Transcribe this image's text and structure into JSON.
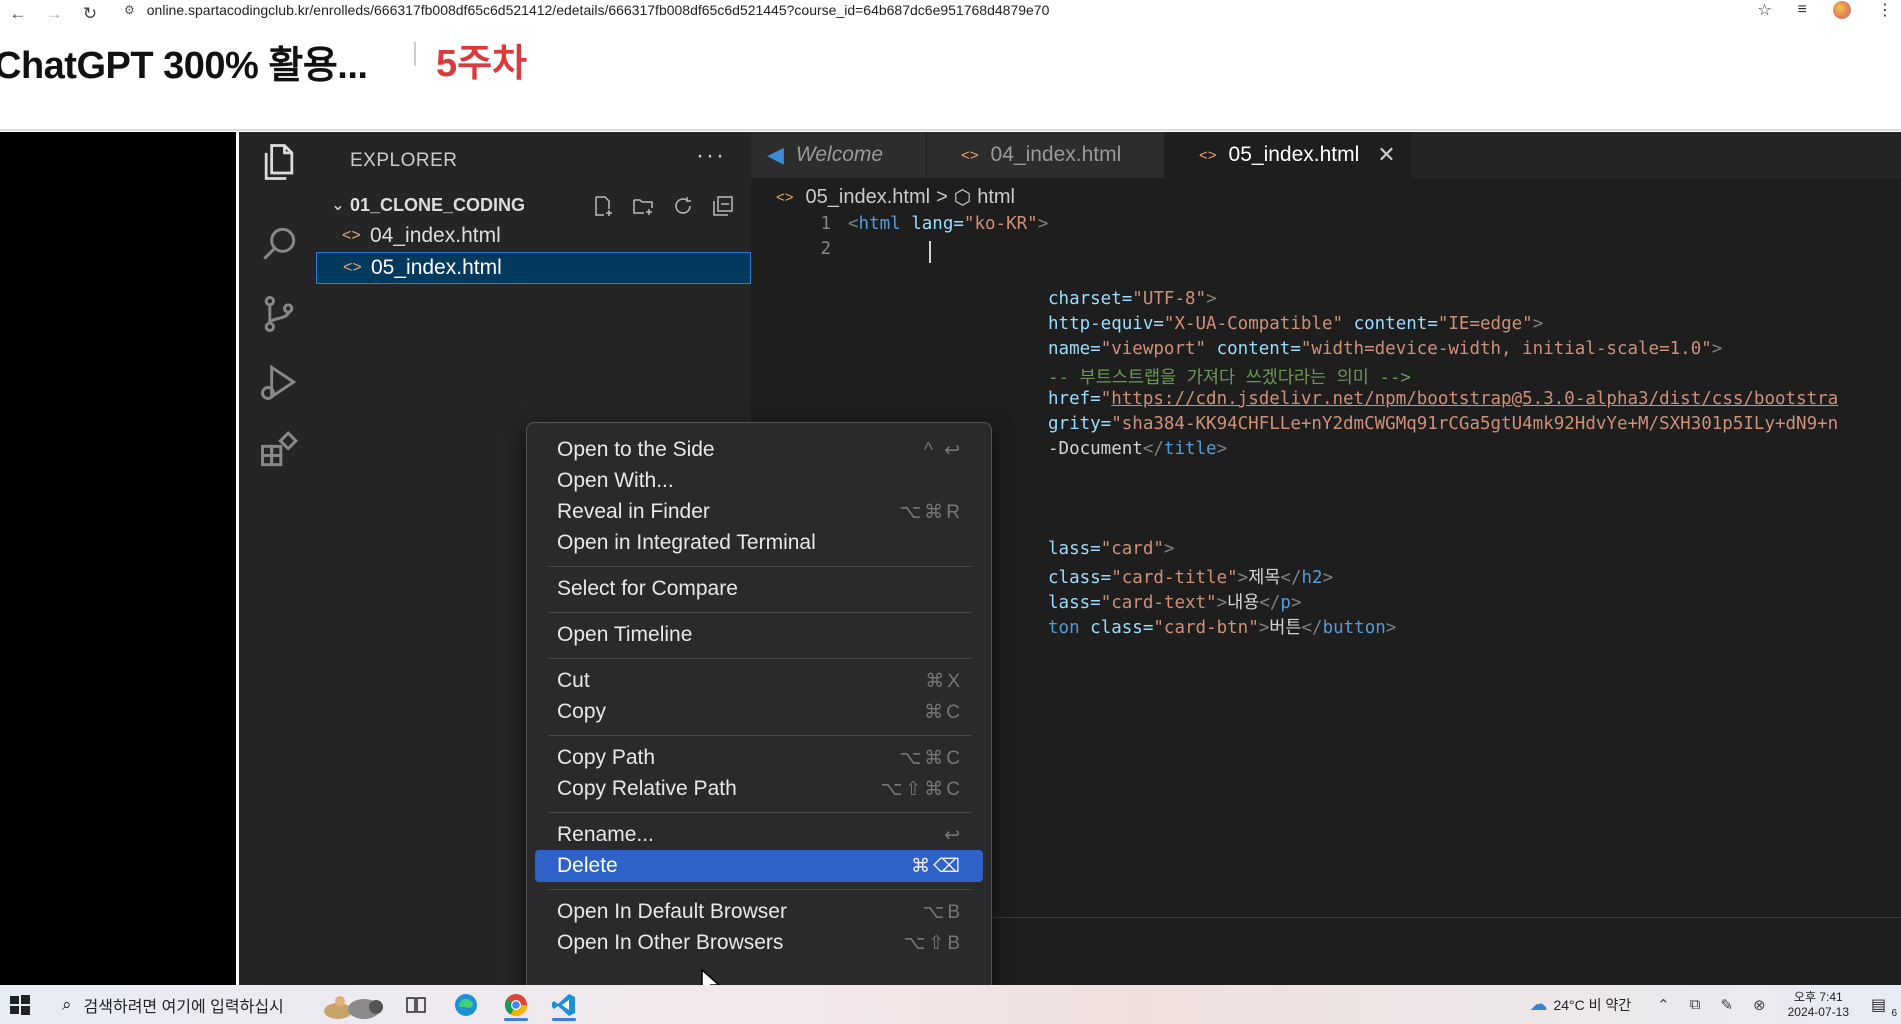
{
  "browser": {
    "url": "online.spartacodingclub.kr/enrolleds/666317fb008df65c6d521412/edetails/666317fb008df65c6d521445?course_id=64b687dc6e951768d4879e70"
  },
  "page": {
    "course_title": "ChatGPT 300% 활용...",
    "week_label": "5주차"
  },
  "vscode": {
    "sidebar": {
      "title": "EXPLORER",
      "more": "···",
      "folder": "01_CLONE_CODING",
      "files": [
        "04_index.html",
        "05_index.html"
      ]
    },
    "tabs": [
      {
        "label": "Welcome"
      },
      {
        "label": "04_index.html"
      },
      {
        "label": "05_index.html",
        "close": "✕"
      }
    ],
    "breadcrumb": {
      "file": "05_index.html",
      "separator": ">",
      "symbol": "html"
    },
    "editor": {
      "line_numbers": [
        "1",
        "2"
      ],
      "lines": {
        "l1": {
          "open": "<",
          "tag": "html",
          "attr": " lang=",
          "val": "\"ko-KR\"",
          "close": ">"
        },
        "l3": {
          "attr": "charset=",
          "val": "\"UTF-8\"",
          "close": ">"
        },
        "l4": {
          "attr1": "http-equiv=",
          "val1": "\"X-UA-Compatible\"",
          "attr2": " content=",
          "val2": "\"IE=edge\"",
          "close": ">"
        },
        "l5": {
          "attr1": "name=",
          "val1": "\"viewport\"",
          "attr2": " content=",
          "val2": "\"width=device-width, initial-scale=1.0\"",
          "close": ">"
        },
        "l6": {
          "comment": "-- 부트스트랩을 가져다 쓰겠다라는 의미 -->"
        },
        "l7": {
          "attr": "href=",
          "q": "\"",
          "link": "https://cdn.jsdelivr.net/npm/bootstrap@5.3.0-alpha3/dist/css/bootstra"
        },
        "l8": {
          "attr": "grity=",
          "val": "\"sha384-KK94CHFLLe+nY2dmCWGMq91rCGa5gtU4mk92HdvYe+M/SXH301p5ILy+dN9+n"
        },
        "l9": {
          "text": "-Document",
          "end": "</",
          "tag": "title",
          "close": ">"
        },
        "l10": {
          "attr": "lass=",
          "val": "\"card\"",
          "close": ">"
        },
        "l11": {
          "attr": "class=",
          "val": "\"card-title\"",
          "close": ">",
          "text": "제목",
          "end": "</",
          "tag": "h2",
          "close2": ">"
        },
        "l12": {
          "attr": "lass=",
          "val": "\"card-text\"",
          "close": ">",
          "text": "내용",
          "end": "</",
          "tag": "p",
          "close2": ">"
        },
        "l13": {
          "tag": "ton",
          "attr": " class=",
          "val": "\"card-btn\"",
          "close": ">",
          "text": "버튼",
          "end": "</",
          "tag2": "button",
          "close2": ">"
        }
      }
    },
    "context_menu": {
      "items": [
        {
          "label": "Open to the Side",
          "shortcut": "^ ↩"
        },
        {
          "label": "Open With...",
          "shortcut": ""
        },
        {
          "label": "Reveal in Finder",
          "shortcut": "⌥⌘R"
        },
        {
          "label": "Open in Integrated Terminal",
          "shortcut": ""
        },
        {
          "label": "Select for Compare",
          "shortcut": ""
        },
        {
          "label": "Open Timeline",
          "shortcut": ""
        },
        {
          "label": "Cut",
          "shortcut": "⌘X"
        },
        {
          "label": "Copy",
          "shortcut": "⌘C"
        },
        {
          "label": "Copy Path",
          "shortcut": "⌥⌘C"
        },
        {
          "label": "Copy Relative Path",
          "shortcut": "⌥⇧⌘C"
        },
        {
          "label": "Rename...",
          "shortcut": "↩"
        },
        {
          "label": "Delete",
          "shortcut": "⌘⌫"
        },
        {
          "label": "Open In Default Browser",
          "shortcut": "⌥B"
        },
        {
          "label": "Open In Other Browsers",
          "shortcut": "⌥⇧B"
        }
      ]
    }
  },
  "taskbar": {
    "search_placeholder": "검색하려면 여기에 입력하십시",
    "weather": "24°C  비 약간",
    "time": "오후 7:41",
    "date": "2024-07-13",
    "notification_count": "6"
  },
  "colors": {
    "week_label": "#d83b3b",
    "menu_highlight": "#2f62c9",
    "selection": "#04395e"
  }
}
